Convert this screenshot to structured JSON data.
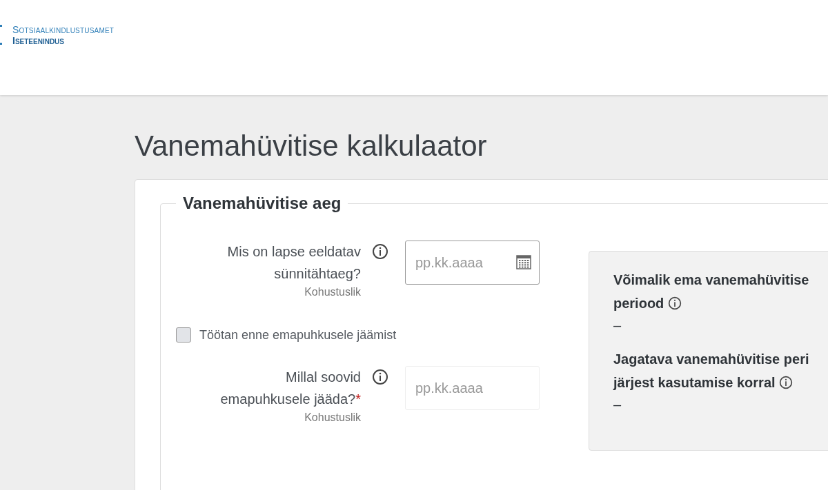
{
  "header": {
    "logo_line_1": "Sotsiaalkindlustusamet",
    "logo_line_2": "Iseteenindus"
  },
  "page_title": "Vanemahüvitise kalkulaator",
  "section": {
    "legend": "Vanemahüvitise aeg",
    "fields": [
      {
        "kind": "date",
        "label": "Mis on lapse eeldatav sünnitähtaeg?",
        "hint": "Kohustuslik",
        "placeholder": "pp.kk.aaaa",
        "disabled": false
      },
      {
        "kind": "checkbox",
        "label": "Töötan enne emapuhkusele jäämist",
        "checked": false
      },
      {
        "kind": "date",
        "label": "Millal soovid emapuhkusele jääda?",
        "required_mark": "*",
        "hint": "Kohustuslik",
        "placeholder": "pp.kk.aaaa",
        "disabled": true
      }
    ],
    "results": [
      {
        "title": "Võimalik ema vanemahüvitise periood",
        "value": "–"
      },
      {
        "title": "Jagatava vanemahüvitise peri järjest kasutamise korral",
        "value": "–"
      }
    ]
  }
}
